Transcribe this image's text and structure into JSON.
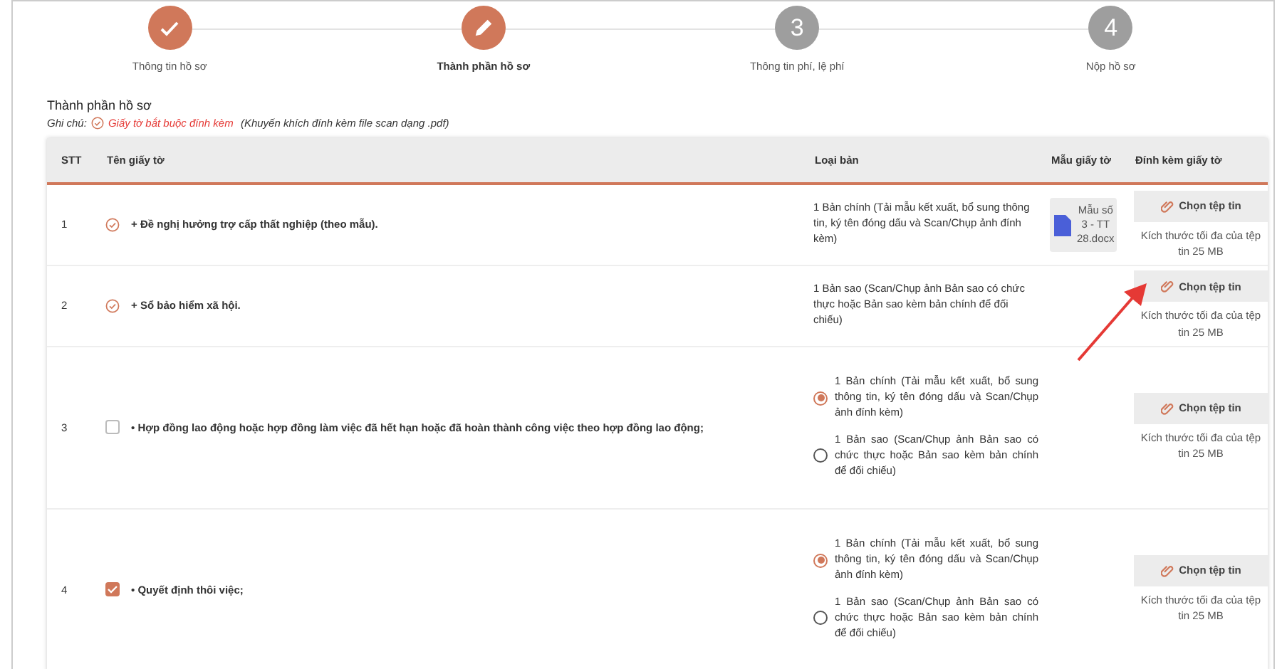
{
  "steps": [
    {
      "kind": "done",
      "label": "Thông tin hồ sơ",
      "selected": false
    },
    {
      "kind": "edit",
      "label": "Thành phần hồ sơ",
      "selected": true
    },
    {
      "kind": "number",
      "number": "3",
      "label": "Thông tin phí, lệ phí",
      "selected": false
    },
    {
      "kind": "number",
      "number": "4",
      "label": "Nộp hồ sơ",
      "selected": false
    }
  ],
  "section": {
    "title": "Thành phần hồ sơ",
    "note_label": "Ghi chú:",
    "note_required": "Giấy tờ bắt buộc đính kèm",
    "note_hint": "(Khuyến khích đính kèm file scan dạng .pdf)"
  },
  "table": {
    "columns": [
      "STT",
      "Tên giấy tờ",
      "Loại bản",
      "Mẫu giấy tờ",
      "Đính kèm giấy tờ"
    ],
    "rows": [
      {
        "stt": "1",
        "kind": "required",
        "name": "+ Đề nghị hưởng trợ cấp thất nghiệp (theo mẫu).",
        "types": [
          {
            "text": "1 Bản chính (Tải mẫu kết xuất, bổ sung thông tin, ký tên đóng dấu và Scan/Chụp ảnh đính kèm)"
          }
        ],
        "template": "Mẫu số 3 - TT 28.docx",
        "attach": {
          "button": "Chọn tệp tin",
          "note": "Kích thước tối đa của tệp tin 25 MB"
        }
      },
      {
        "stt": "2",
        "kind": "required",
        "name": "+ Sổ bảo hiểm xã hội.",
        "types": [
          {
            "text": "1 Bản sao (Scan/Chụp ảnh Bản sao có chức thực hoặc Bản sao kèm bản chính để đối chiếu)"
          }
        ],
        "attach": {
          "button": "Chọn tệp tin",
          "note": "Kích thước tối đa của tệp tin 25 MB"
        }
      },
      {
        "stt": "3",
        "kind": "optional",
        "checked": false,
        "name": "• Hợp đồng lao động hoặc hợp đồng làm việc đã hết hạn hoặc đã hoàn thành công việc theo hợp đồng lao động;",
        "types": [
          {
            "text": "1 Bản chính (Tải mẫu kết xuất, bổ sung thông tin, ký tên đóng dấu và Scan/Chụp ảnh đính kèm)",
            "selected": true
          },
          {
            "text": "1 Bản sao (Scan/Chụp ảnh Bản sao có chức thực hoặc Bản sao kèm bản chính để đối chiếu)",
            "selected": false
          }
        ],
        "attach": {
          "button": "Chọn tệp tin",
          "note": "Kích thước tối đa của tệp tin 25 MB"
        }
      },
      {
        "stt": "4",
        "kind": "optional",
        "checked": true,
        "name": "• Quyết định thôi việc;",
        "types": [
          {
            "text": "1 Bản chính (Tải mẫu kết xuất, bổ sung thông tin, ký tên đóng dấu và Scan/Chụp ảnh đính kèm)",
            "selected": true
          },
          {
            "text": "1 Bản sao (Scan/Chụp ảnh Bản sao có chức thực hoặc Bản sao kèm bản chính để đối chiếu)",
            "selected": false
          }
        ],
        "attach": {
          "button": "Chọn tệp tin",
          "note": "Kích thước tối đa của tệp tin 25 MB"
        }
      }
    ]
  }
}
